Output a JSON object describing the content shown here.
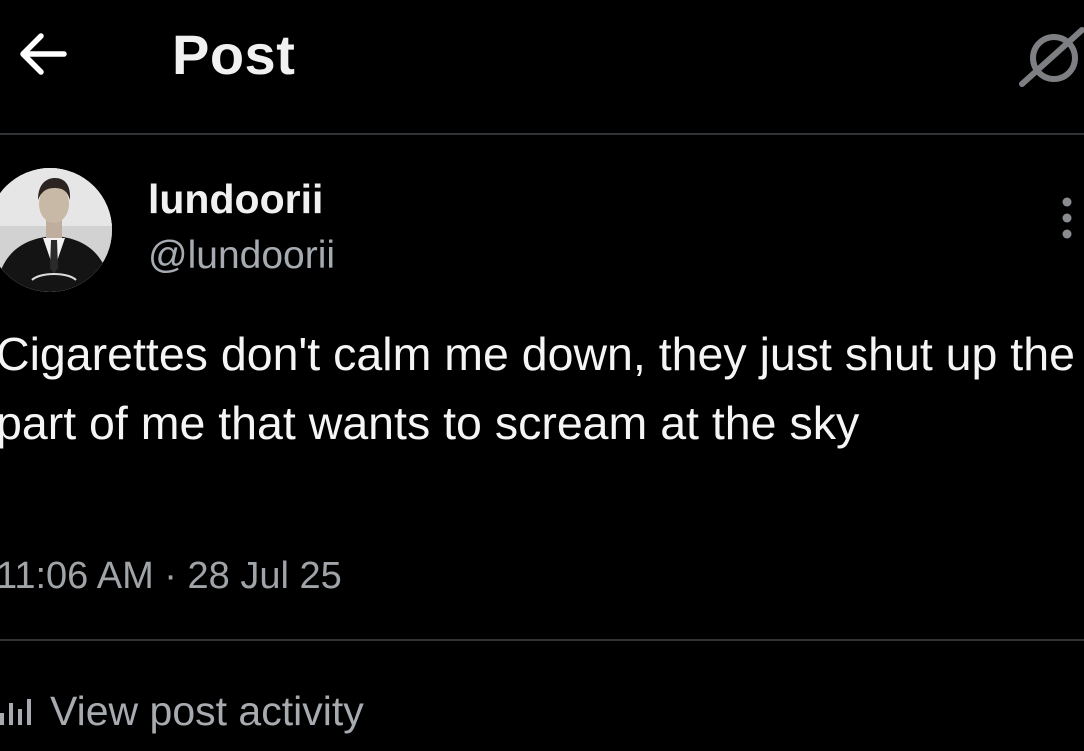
{
  "header": {
    "title": "Post",
    "back_icon": "arrow-left-icon",
    "grok_icon": "grok-icon"
  },
  "post": {
    "author": {
      "display_name": "lundoorii",
      "handle": "@lundoorii",
      "avatar_icon": "avatar"
    },
    "more_icon": "more-vertical-icon",
    "text": "Cigarettes don't calm me down, they just shut up the part of me that wants to scream at the sky",
    "time": "11:06 AM",
    "separator": "·",
    "date": "28 Jul 25"
  },
  "activity": {
    "icon": "bar-chart-icon",
    "label": "View post activity"
  },
  "colors": {
    "background": "#000000",
    "divider": "#2f3336",
    "primary_text": "#f5f5f5",
    "secondary_text": "#a5abb0"
  }
}
